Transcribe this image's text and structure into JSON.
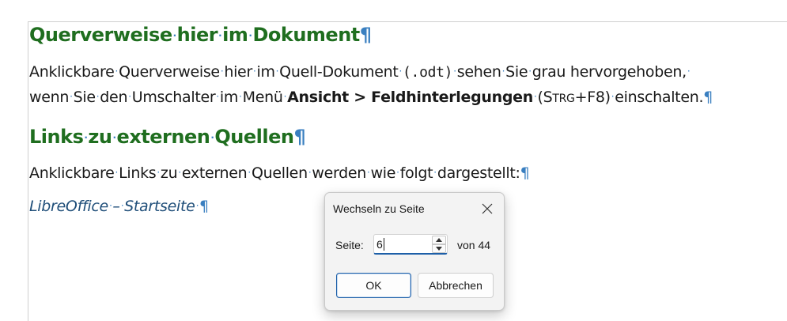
{
  "document": {
    "heading1": {
      "words": [
        "Querverweise",
        "hier",
        "im",
        "Dokument"
      ],
      "pilcrow": "¶"
    },
    "para1": {
      "line1_a": "Anklickbare",
      "line1_b": "Querverweise",
      "line1_c": "hier",
      "line1_d": "im",
      "line1_e": "Quell-Dokument",
      "line1_code": "(.odt)",
      "line1_f": "sehen",
      "line1_g": "Sie",
      "line1_h": "grau hervorgehoben,",
      "line2_a": "wenn",
      "line2_b": "Sie",
      "line2_c": "den",
      "line2_d": "Umschalter",
      "line2_e": "im",
      "line2_f": "Menü",
      "line2_bold": "Ansicht > Feldhinterlegungen",
      "line2_paren_open": "(S",
      "line2_smallcaps": "TRG",
      "line2_paren_rest": "+F8)",
      "line2_g": "einschalten.",
      "pilcrow": "¶"
    },
    "heading2": {
      "words": [
        "Links",
        "zu",
        "externen",
        "Quellen"
      ],
      "pilcrow": "¶"
    },
    "para2": {
      "words": [
        "Anklickbare",
        "Links",
        "zu",
        "externen",
        "Quellen",
        "werden",
        "wie",
        "folgt",
        "dargestellt:"
      ],
      "pilcrow": "¶"
    },
    "link": {
      "part1": "LibreOffice",
      "part2": "–",
      "part3": "Startseite",
      "pilcrow": "¶"
    },
    "dot": "·"
  },
  "dialog": {
    "title": "Wechseln zu Seite",
    "close_icon": "close-icon",
    "page_label": "Seite:",
    "page_value": "6",
    "of_label": "von 44",
    "ok_label": "OK",
    "cancel_label": "Abbrechen"
  },
  "colors": {
    "heading": "#1f6e1f",
    "pilcrow": "#3a7fc0",
    "link": "#1f4e79",
    "focus_accent": "#1d5fa8"
  }
}
